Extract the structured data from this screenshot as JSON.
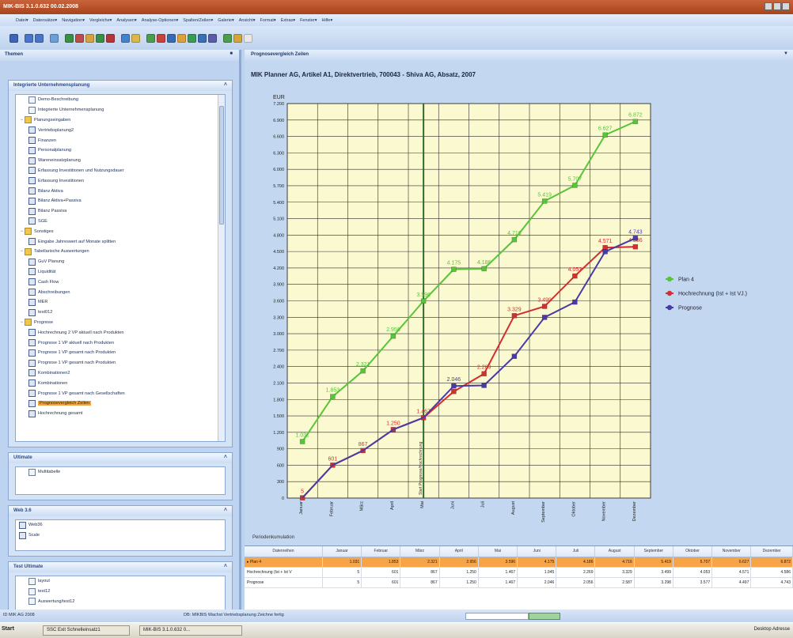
{
  "app": {
    "title": "MIK-BIS 3.1.0.632 00.02.2008"
  },
  "menu": [
    "Datei",
    "Datensätze",
    "Navigation",
    "Vergleiche",
    "Analysen",
    "Analyse-Optionen",
    "Spalten/Zeilen",
    "Galerie",
    "Ansicht",
    "Format",
    "Extras",
    "Fenster",
    "Hilfe"
  ],
  "left_panel": {
    "header": "Themen",
    "groups": [
      {
        "title": "Integrierte Unternehmensplanung",
        "items": [
          {
            "label": "Demo-Beschreibung",
            "level": 1,
            "icon": "doc-icon"
          },
          {
            "label": "Integrierte Unternehmensplanung",
            "level": 1,
            "icon": "doc-icon"
          },
          {
            "label": "Planungseingaben",
            "level": 0,
            "icon": "folder-icon"
          },
          {
            "label": "Vertriebsplanung2",
            "level": 1,
            "icon": "grid-icon"
          },
          {
            "label": "Finanzen",
            "level": 1,
            "icon": "grid-icon"
          },
          {
            "label": "Personalplanung",
            "level": 1,
            "icon": "grid-icon"
          },
          {
            "label": "Wareneinsatzplanung",
            "level": 1,
            "icon": "grid-icon"
          },
          {
            "label": "Erfassung Investitionen und Nutzungsdauer",
            "level": 1,
            "icon": "grid-icon"
          },
          {
            "label": "Erfassung Investitionen",
            "level": 1,
            "icon": "grid-icon"
          },
          {
            "label": "Bilanz Aktiva",
            "level": 1,
            "icon": "grid-icon"
          },
          {
            "label": "Bilanz Aktiva+Passiva",
            "level": 1,
            "icon": "grid-icon"
          },
          {
            "label": "Bilanz Passiva",
            "level": 1,
            "icon": "grid-icon"
          },
          {
            "label": "SGE",
            "level": 1,
            "icon": "grid-icon"
          },
          {
            "label": "Sonstiges",
            "level": 0,
            "icon": "folder-icon"
          },
          {
            "label": "Eingabe Jahreswert auf Monate splitten",
            "level": 1,
            "icon": "grid-icon"
          },
          {
            "label": "Tabellarische Auswertungen",
            "level": 0,
            "icon": "folder-icon"
          },
          {
            "label": "GuV Planung",
            "level": 1,
            "icon": "grid-icon"
          },
          {
            "label": "Liquidität",
            "level": 1,
            "icon": "grid-icon"
          },
          {
            "label": "Cash Flow",
            "level": 1,
            "icon": "grid-icon"
          },
          {
            "label": "Abschreibungen",
            "level": 1,
            "icon": "grid-icon"
          },
          {
            "label": "MER",
            "level": 1,
            "icon": "grid-icon"
          },
          {
            "label": "test012",
            "level": 1,
            "icon": "grid-icon"
          },
          {
            "label": "Prognose",
            "level": 0,
            "icon": "folder-icon"
          },
          {
            "label": "Hochrechnung 2 VP aktuell nach Produkten",
            "level": 1,
            "icon": "grid-icon"
          },
          {
            "label": "Prognose 1 VP aktuell nach Produkten",
            "level": 1,
            "icon": "grid-icon"
          },
          {
            "label": "Prognose 1 VP gesamt nach Produkten",
            "level": 1,
            "icon": "grid-icon"
          },
          {
            "label": "Prognose 1 VP gesamt nach Produkten",
            "level": 1,
            "icon": "grid-icon"
          },
          {
            "label": "Kombinationen2",
            "level": 1,
            "icon": "grid-icon"
          },
          {
            "label": "Kombinationen",
            "level": 1,
            "icon": "grid-icon"
          },
          {
            "label": "Prognose 1 VP gesamt nach Gesellschaften",
            "level": 1,
            "icon": "grid-icon"
          },
          {
            "label": "Prognosevergleich Zeilen",
            "level": 1,
            "icon": "grid-icon",
            "selected": true
          },
          {
            "label": "Hochrechnung gesamt",
            "level": 1,
            "icon": "grid-icon"
          }
        ]
      },
      {
        "title": "Ultimate",
        "items": [
          {
            "label": "Multitabelle",
            "level": 1,
            "icon": "doc-icon"
          }
        ]
      },
      {
        "title": "Web 3.6",
        "items": [
          {
            "label": "Web36",
            "level": 0,
            "icon": "grid-icon"
          },
          {
            "label": "Scale",
            "level": 0,
            "icon": "grid-icon"
          }
        ]
      },
      {
        "title": "Test Ultimate",
        "items": [
          {
            "label": "layout",
            "level": 1,
            "icon": "doc-icon"
          },
          {
            "label": "test12",
            "level": 1,
            "icon": "doc-icon"
          },
          {
            "label": "Auswertung/test12",
            "level": 1,
            "icon": "doc-icon"
          }
        ]
      }
    ]
  },
  "main": {
    "header": "Prognosevergleich Zeilen",
    "chart_title": "MIK Planner AG, Artikel A1, Direktvertrieb, 700043  -  Shiva AG, Absatz, 2007",
    "period_label": "Periodenkumulation"
  },
  "chart_data": {
    "type": "line",
    "ylabel": "EUR",
    "ylim": [
      0,
      7200
    ],
    "yticks": [
      0,
      300,
      600,
      900,
      1200,
      1500,
      1800,
      2100,
      2400,
      2700,
      3000,
      3300,
      3600,
      3900,
      4200,
      4500,
      4800,
      5100,
      5400,
      5700,
      6000,
      6300,
      6600,
      6900,
      7200
    ],
    "categories": [
      "Januar",
      "Februar",
      "März",
      "April",
      "Mai",
      "Juni",
      "Juli",
      "August",
      "September",
      "Oktober",
      "November",
      "Dezember"
    ],
    "marker_label": "Start Prognose/Hochrechnung",
    "marker_after_index": 4,
    "legend_position": "right",
    "series": [
      {
        "name": "Plan 4",
        "color": "#58c43a",
        "values": [
          1031,
          1853,
          2321,
          2956,
          3596,
          4175,
          4186,
          4716,
          5419,
          5707,
          6627,
          6872
        ],
        "labels": [
          "1.031",
          "1.853",
          "2.321",
          "2.956",
          "3.596",
          "4.175",
          "4.186",
          "4.716",
          "5.419",
          "5.707",
          "6.627",
          "6.872"
        ]
      },
      {
        "name": "Hochrechnung (Ist + Ist VJ.)",
        "color": "#d23030",
        "values": [
          5,
          601,
          867,
          1250,
          1467,
          1945,
          2269,
          3329,
          3499,
          4053,
          4571,
          4586
        ],
        "labels": [
          "5",
          "601",
          "867",
          "1.250",
          "1.467",
          "",
          "2.269",
          "3.329",
          "3.499",
          "4.053",
          "4.571",
          "4.586"
        ]
      },
      {
        "name": "Prognose",
        "color": "#4a3aa8",
        "values": [
          5,
          601,
          867,
          1250,
          1467,
          2046,
          2056,
          2587,
          3298,
          3577,
          4497,
          4743
        ],
        "labels": [
          "",
          "",
          "",
          "",
          "",
          "2.046",
          "",
          "",
          "",
          "",
          "",
          "4.743"
        ]
      }
    ]
  },
  "table": {
    "columns": [
      "Datenreihen",
      "Januar",
      "Februar",
      "März",
      "April",
      "Mai",
      "Juni",
      "Juli",
      "August",
      "September",
      "Oktober",
      "November",
      "Dezember"
    ],
    "rows": [
      [
        "Plan 4",
        "1.031",
        "1.853",
        "2.321",
        "2.956",
        "3.596",
        "4.175",
        "4.186",
        "4.716",
        "5.419",
        "5.707",
        "6.627",
        "6.872"
      ],
      [
        "Hochrechnung (Ist + Ist V",
        "5",
        "601",
        "867",
        "1.250",
        "1.467",
        "1.945",
        "2.269",
        "3.329",
        "3.499",
        "4.053",
        "4.571",
        "4.586"
      ],
      [
        "Prognose",
        "5",
        "601",
        "867",
        "1.250",
        "1.467",
        "2.046",
        "2.056",
        "2.587",
        "3.298",
        "3.577",
        "4.497",
        "4.743"
      ]
    ]
  },
  "status": {
    "left": "ID MIK AG 2008",
    "mid": "DB: MIKBIS Wachst Vertriebsplanung    Zeichne fertig"
  },
  "taskbar": {
    "start": "Start",
    "task1": "SSC Exit Schnelleinsatz1",
    "task2": "MIK-BIS 3.1.0.632 0...",
    "tray": "Desktop  Adresse"
  },
  "colors": {
    "plot_bg": "#fbf9cf",
    "marker_line": "#2e6b2e",
    "highlight_row": "#f7a348"
  }
}
